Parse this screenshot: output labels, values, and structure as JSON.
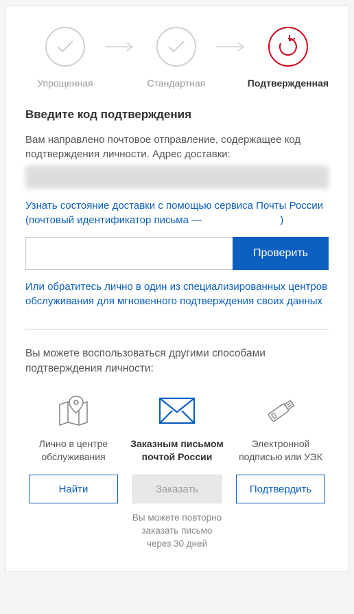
{
  "steps": {
    "simplified": "Упрощенная",
    "standard": "Стандартная",
    "confirmed": "Подтвержденная"
  },
  "heading": "Введите код подтверждения",
  "intro": "Вам направлено почтовое отправление, содержащее код подтверждения личности. Адрес доставки:",
  "tracking_link_part1": "Узнать состояние доставки с помощью сервиса Почты России (почтовый идентификатор письма — ",
  "tracking_link_part2": ")",
  "check_button": "Проверить",
  "centers_link": "Или обратитесь лично в один из специализированных центров обслуживания для мгновенного подтверждения своих данных",
  "alt_heading": "Вы можете воспользоваться другими способами подтверждения личности:",
  "options": {
    "center": {
      "label": "Лично в центре обслуживания",
      "button": "Найти"
    },
    "mail": {
      "label": "Заказным письмом почтой России",
      "button": "Заказать"
    },
    "esig": {
      "label": "Электронной подписью или УЭК",
      "button": "Подтвердить"
    }
  },
  "reorder_note": "Вы можете повторно заказать письмо через 30 дней"
}
